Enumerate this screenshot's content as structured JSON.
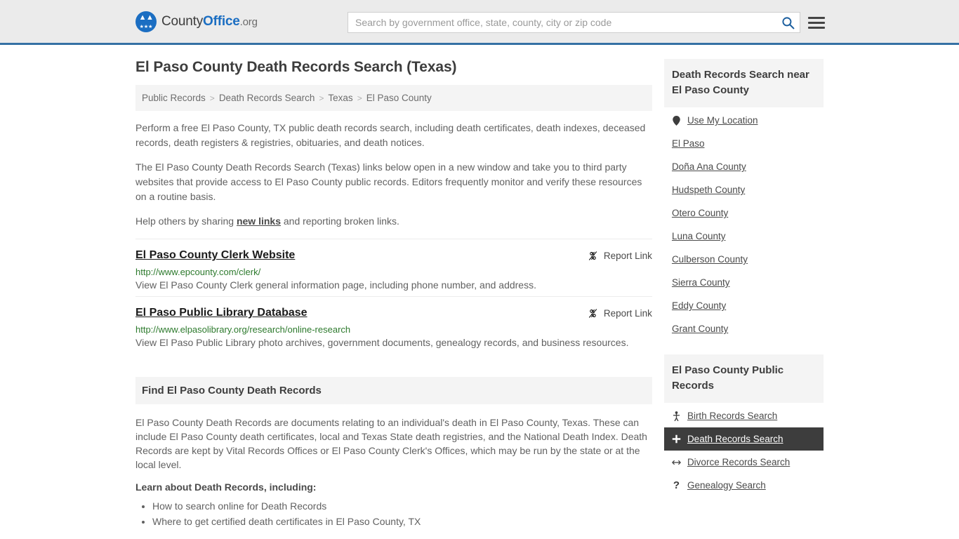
{
  "header": {
    "logo": {
      "part1": "County",
      "part2": "Office",
      "part3": ".org",
      "seal_icon": "eagle-seal-icon",
      "brand_blue": "#1b6ec2"
    },
    "search": {
      "placeholder": "Search by government office, state, county, city or zip code",
      "value": "",
      "search_icon": "search-icon"
    },
    "menu_icon": "hamburger-menu-icon",
    "accent_border": "#3571a4"
  },
  "main": {
    "page_title": "El Paso County Death Records Search (Texas)",
    "breadcrumb": [
      {
        "label": "Public Records"
      },
      {
        "label": "Death Records Search"
      },
      {
        "label": "Texas"
      },
      {
        "label": "El Paso County"
      }
    ],
    "breadcrumb_separator": ">",
    "intro": [
      "Perform a free El Paso County, TX public death records search, including death certificates, death indexes, deceased records, death registers & registries, obituaries, and death notices.",
      "The El Paso County Death Records Search (Texas) links below open in a new window and take you to third party websites that provide access to El Paso County public records. Editors frequently monitor and verify these resources on a routine basis."
    ],
    "help_prefix": "Help others by sharing ",
    "help_link": "new links",
    "help_suffix": " and reporting broken links.",
    "report_link_label": "Report Link",
    "report_link_icon": "broken-link-icon",
    "results": [
      {
        "title": "El Paso County Clerk Website",
        "url": "http://www.epcounty.com/clerk/",
        "description": "View El Paso County Clerk general information page, including phone number, and address."
      },
      {
        "title": "El Paso Public Library Database",
        "url": "http://www.elpasolibrary.org/research/online-research",
        "description": "View El Paso Public Library photo archives, government documents, genealogy records, and business resources."
      }
    ],
    "find_section": {
      "heading": "Find El Paso County Death Records",
      "paragraph": "El Paso County Death Records are documents relating to an individual's death in El Paso County, Texas. These can include El Paso County death certificates, local and Texas State death registries, and the National Death Index. Death Records are kept by Vital Records Offices or El Paso County Clerk's Offices, which may be run by the state or at the local level.",
      "learn_label": "Learn about Death Records, including:",
      "learn_items": [
        "How to search online for Death Records",
        "Where to get certified death certificates in El Paso County, TX"
      ]
    }
  },
  "sidebar": {
    "nearby": {
      "heading": "Death Records Search near El Paso County",
      "items": [
        {
          "label": "Use My Location",
          "icon": "map-pin-icon",
          "glyph": "•"
        },
        {
          "label": "El Paso",
          "icon": "",
          "glyph": ""
        },
        {
          "label": "Doña Ana County",
          "icon": "",
          "glyph": ""
        },
        {
          "label": "Hudspeth County",
          "icon": "",
          "glyph": ""
        },
        {
          "label": "Otero County",
          "icon": "",
          "glyph": ""
        },
        {
          "label": "Luna County",
          "icon": "",
          "glyph": ""
        },
        {
          "label": "Culberson County",
          "icon": "",
          "glyph": ""
        },
        {
          "label": "Sierra County",
          "icon": "",
          "glyph": ""
        },
        {
          "label": "Eddy County",
          "icon": "",
          "glyph": ""
        },
        {
          "label": "Grant County",
          "icon": "",
          "glyph": ""
        }
      ]
    },
    "public_records": {
      "heading": "El Paso County Public Records",
      "active_index": 1,
      "items": [
        {
          "label": "Birth Records Search",
          "icon": "baby-icon",
          "glyph": "Ɔ"
        },
        {
          "label": "Death Records Search",
          "icon": "cross-icon",
          "glyph": "✚"
        },
        {
          "label": "Divorce Records Search",
          "icon": "double-arrow-icon",
          "glyph": "↔"
        },
        {
          "label": "Genealogy Search",
          "icon": "question-mark-icon",
          "glyph": "?"
        }
      ]
    }
  }
}
